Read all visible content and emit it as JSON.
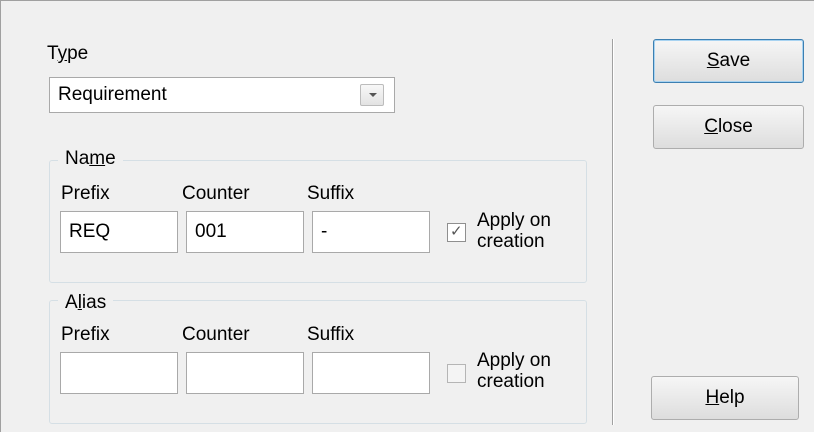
{
  "type": {
    "label_pre": "T",
    "label_u": "y",
    "label_post": "pe",
    "value": "Requirement"
  },
  "name_group": {
    "legend_pre": "Na",
    "legend_u": "m",
    "legend_post": "e",
    "prefix_label": "Prefix",
    "counter_label": "Counter",
    "suffix_label": "Suffix",
    "prefix_value": "REQ",
    "counter_value": "001",
    "suffix_value": "-",
    "apply_label_line1": "Apply on",
    "apply_label_line2": "creation",
    "apply_checked": true
  },
  "alias_group": {
    "legend_pre": "A",
    "legend_u": "l",
    "legend_post": "ias",
    "prefix_label": "Prefix",
    "counter_label": "Counter",
    "suffix_label": "Suffix",
    "prefix_value": "",
    "counter_value": "",
    "suffix_value": "",
    "apply_label_line1": "Apply on",
    "apply_label_line2": "creation",
    "apply_checked": false
  },
  "buttons": {
    "save_u": "S",
    "save_rest": "ave",
    "close_u": "C",
    "close_rest": "lose",
    "help_u": "H",
    "help_rest": "elp"
  }
}
